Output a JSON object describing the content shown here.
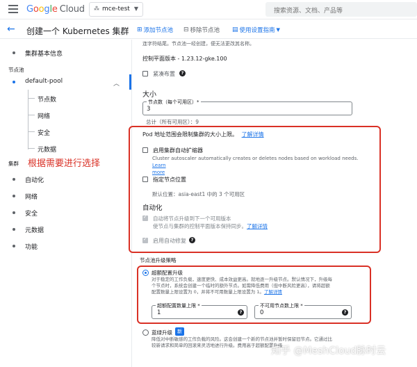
{
  "topbar": {
    "logo_google": [
      "G",
      "o",
      "o",
      "g",
      "l",
      "e"
    ],
    "logo_cloud": "Cloud",
    "project": "mce-test",
    "search_placeholder": "搜索资源、文档、产品等"
  },
  "header": {
    "title": "创建一个 Kubernetes 集群",
    "add_pool": "添加节点池",
    "remove_pool": "移除节点池",
    "use_settings": "使用设置指南"
  },
  "sidebar": {
    "basics": "集群基本信息",
    "section_nodepool": "节点池",
    "pool_name": "default-pool",
    "pool_children": [
      "节点数",
      "网络",
      "安全",
      "元数据"
    ],
    "section_cluster": "集群",
    "cluster_items": [
      "自动化",
      "网络",
      "安全",
      "元数据",
      "功能"
    ]
  },
  "annotation": "根据需要进行选择",
  "main": {
    "top_note": "连字符结尾。节点池一经创建，便无法更改其名称。",
    "control_plane_version": "控制平面版本 - 1.23.12-gke.100",
    "compact_placement": "紧凑布置",
    "size_heading": "大小",
    "node_count_label": "节点数（每个可用区）*",
    "node_count_value": "3",
    "total_note": "总计（所有可用区）：9",
    "pod_limit_text": "Pod 地址范围会限制集群的大小上限。",
    "learn_more": "了解详情",
    "autoscaler_label": "启用集群自动扩缩器",
    "autoscaler_desc": "Cluster autoscaler automatically creates or deletes nodes based on workload needs.",
    "autoscaler_link_a": "Learn",
    "autoscaler_link_b": "more",
    "node_location_label": "指定节点位置",
    "default_location": "默认位置：asia-east1 中的 3 个可用区",
    "automation_heading": "自动化",
    "auto_upgrade_label": "自动将节点升级到下一个可用版本",
    "auto_upgrade_desc": "使节点与集群的控制平面版本保持同步。",
    "auto_upgrade_link": "了解详情",
    "auto_repair_label": "启用自动修复",
    "upgrade_strategy_heading": "节点池升级策略",
    "surge_label": "超额配置升级",
    "surge_desc_1": "对于稳定的工作负载，速度更快、成本效益更高。就地逐一升级节点。默认情况下，升级每",
    "surge_desc_2": "个节点时，系统会创建一个临时的额外节点。如需降低费用（但中断风险更高），请将超额",
    "surge_desc_3": "配置数量上限设置为 0，并将不可用数量上限设置为 1。",
    "surge_link": "了解详情",
    "max_surge_label": "超额配置数量上限 *",
    "max_surge_value": "1",
    "max_unavailable_label": "不可用节点数上限 *",
    "max_unavailable_value": "0",
    "bluegreen_label": "蓝绿升级",
    "new_badge": "新",
    "bluegreen_desc_1": "降低对中断敏感的工作负载的风险。这会创建一个新的节点池并暂时保留旧节点。它通过比",
    "bluegreen_desc_2": "较新请求和简单的回滚来灵活地进行升级。费用高于超额配置升级"
  },
  "watermark": "知乎 @MeshCloud脉时云",
  "colors": {
    "accent": "#1a73e8",
    "highlight_box": "#d93025"
  }
}
